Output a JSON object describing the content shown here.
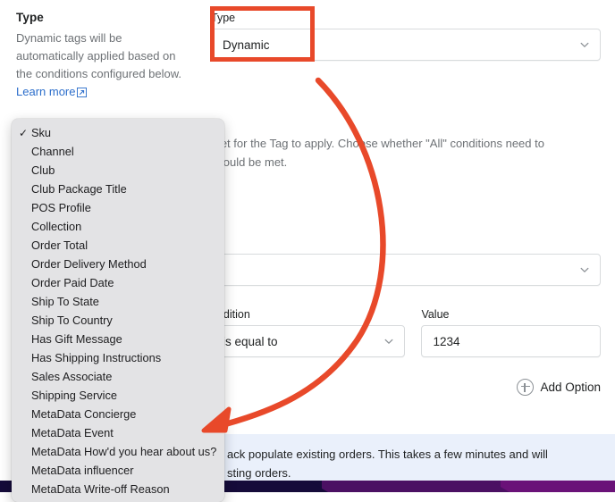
{
  "left_panel": {
    "title": "Type",
    "description_lines": [
      "Dynamic tags will be",
      "automatically applied based on",
      "the conditions configured",
      "below. "
    ],
    "description": "Dynamic tags will be automatically applied based on the conditions configured below. ",
    "learn_more_label": "Learn more",
    "external_link_icon": "external-link-icon"
  },
  "type_field": {
    "label": "Type",
    "value": "Dynamic",
    "chevron_icon": "chevron-down-icon"
  },
  "conditions_help": {
    "text": "met for the Tag to apply. Choose whether \"All\" conditions need to should be met.",
    "line1": "met for the Tag to apply. Choose whether \"All\" conditions need to",
    "line2": "should be met."
  },
  "resource_field": {
    "label": "",
    "value": "",
    "chevron_icon": "chevron-down-icon"
  },
  "condition_field": {
    "label": "ondition",
    "value": "is equal to",
    "chevron_icon": "chevron-down-icon"
  },
  "value_field": {
    "label": "Value",
    "value": "1234",
    "placeholder": ""
  },
  "add_option": {
    "label": "Add Option",
    "icon": "plus-circle-icon"
  },
  "info_banner": {
    "line1": "ack populate existing orders. This takes a few minutes and will",
    "line2": "sting orders."
  },
  "dropdown_menu": {
    "selected": "Sku",
    "check_glyph": "✓",
    "items": [
      {
        "label": "Sku",
        "selected": true
      },
      {
        "label": "Channel",
        "selected": false
      },
      {
        "label": "Club",
        "selected": false
      },
      {
        "label": "Club Package Title",
        "selected": false
      },
      {
        "label": "POS Profile",
        "selected": false
      },
      {
        "label": "Collection",
        "selected": false
      },
      {
        "label": "Order Total",
        "selected": false
      },
      {
        "label": "Order Delivery Method",
        "selected": false
      },
      {
        "label": "Order Paid Date",
        "selected": false
      },
      {
        "label": "Ship To State",
        "selected": false
      },
      {
        "label": "Ship To Country",
        "selected": false
      },
      {
        "label": "Has Gift Message",
        "selected": false
      },
      {
        "label": "Has Shipping Instructions",
        "selected": false
      },
      {
        "label": "Sales Associate",
        "selected": false
      },
      {
        "label": "Shipping Service",
        "selected": false
      },
      {
        "label": "MetaData Concierge",
        "selected": false
      },
      {
        "label": "MetaData Event",
        "selected": false
      },
      {
        "label": "MetaData How'd you hear about us?",
        "selected": false
      },
      {
        "label": "MetaData influencer",
        "selected": false
      },
      {
        "label": "MetaData Write-off Reason",
        "selected": false
      }
    ]
  },
  "annotations": {
    "highlight_color": "#e8492a",
    "arrow_color": "#e8492a",
    "highlight_target": "type-select-field",
    "arrow_target": "dropdown-menu"
  },
  "colors": {
    "accent_link": "#2c6ecb",
    "text_primary": "#202223",
    "text_subdued": "#6d7175",
    "border": "#d8dbdd",
    "banner_bg": "#eaf0fb",
    "menu_bg": "#e3e3e5",
    "annotation_red": "#e8492a",
    "chrome_navy": "#150b3a",
    "chrome_purple": "#4b1063"
  }
}
